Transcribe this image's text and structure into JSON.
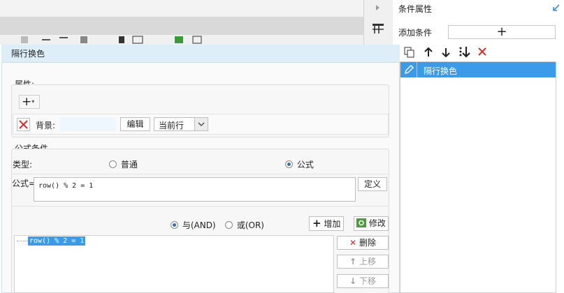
{
  "right_panel": {
    "title": "条件属性",
    "add_label": "添加条件",
    "add_symbol": "+",
    "conditions": [
      "隔行换色"
    ]
  },
  "dialog": {
    "title": "隔行换色",
    "properties": {
      "label": "属性:",
      "add_symbol": "+",
      "row": {
        "name": "背景:",
        "edit_label": "编辑",
        "scope_value": "当前行"
      }
    },
    "formula_condition": {
      "section_label": "公式条件",
      "type_label": "类型:",
      "type_options": [
        {
          "label": "普通",
          "selected": false
        },
        {
          "label": "公式",
          "selected": true
        }
      ],
      "formula_label": "公式=",
      "formula_value": "row() % 2 = 1",
      "define_label": "定义",
      "logic_options": [
        {
          "label": "与(AND)",
          "selected": true
        },
        {
          "label": "或(OR)",
          "selected": false
        }
      ],
      "add_label": "增加",
      "modify_label": "修改",
      "delete_label": "删除",
      "move_up_label": "上移",
      "move_down_label": "下移",
      "conditions": [
        "row() % 2 = 1"
      ]
    }
  },
  "colors": {
    "accent": "#3c9be8",
    "title_bar": "#ddeef9",
    "delete_red": "#d9302c"
  }
}
